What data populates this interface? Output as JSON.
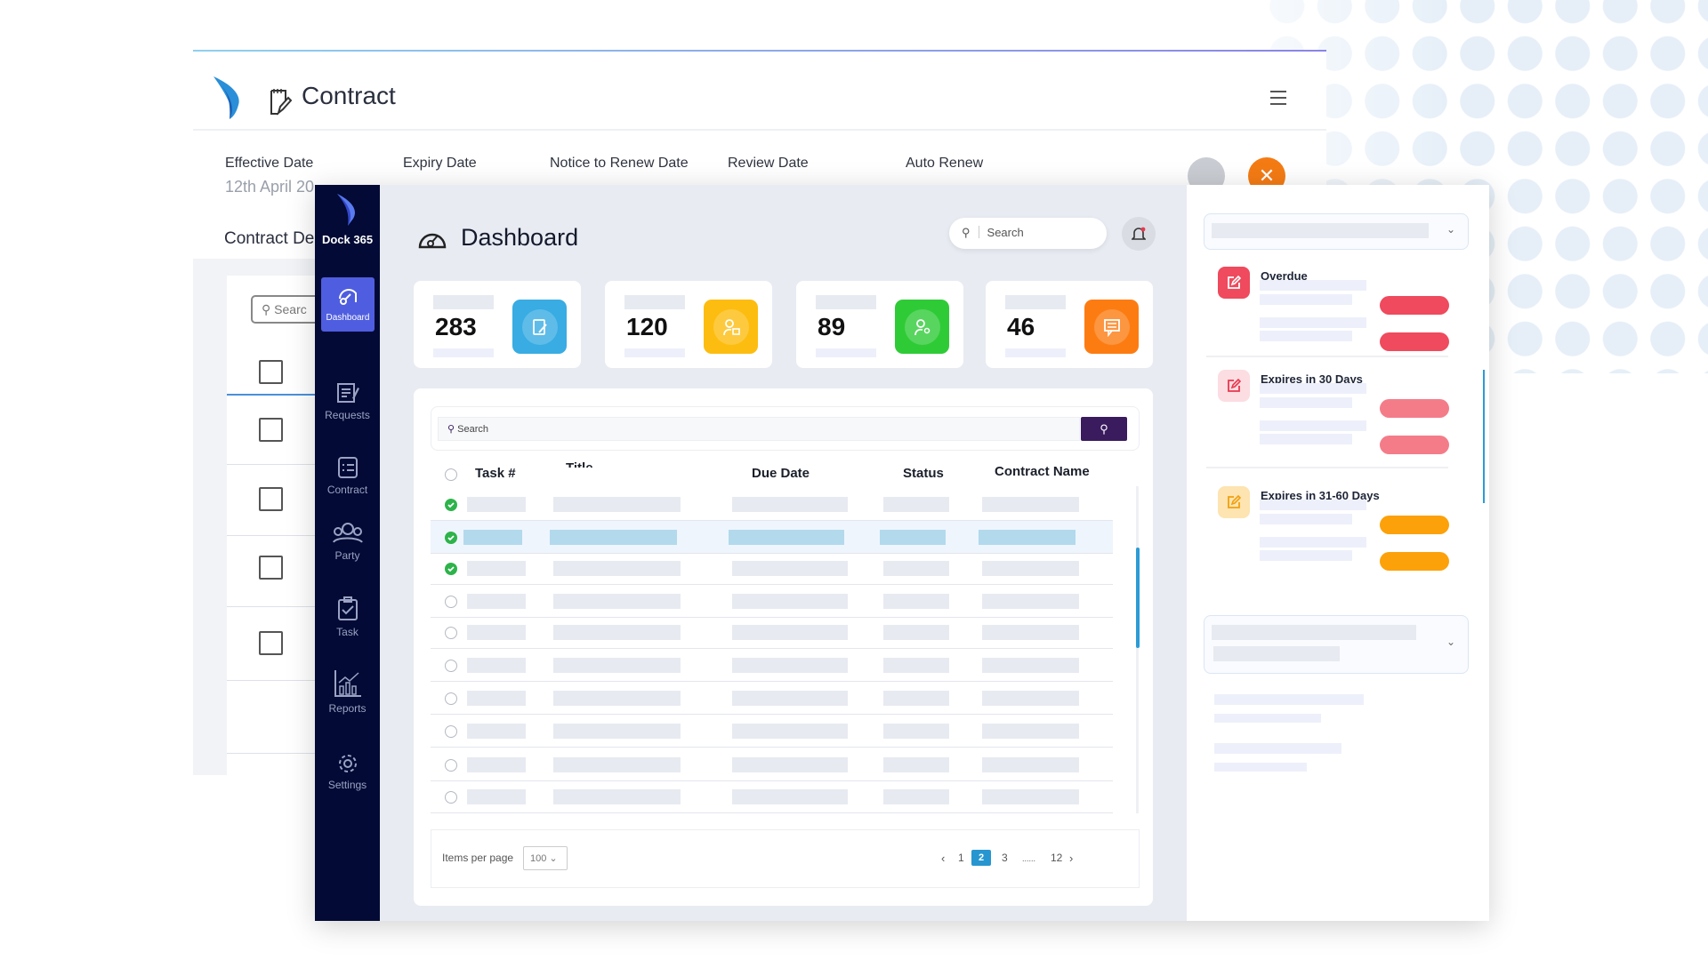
{
  "background_window": {
    "title": "Contract",
    "fields": [
      {
        "label": "Effective Date",
        "value": "12th April 20"
      },
      {
        "label": "Expiry Date",
        "value": ""
      },
      {
        "label": "Notice to Renew Date",
        "value": ""
      },
      {
        "label": "Review Date",
        "value": ""
      },
      {
        "label": "Auto Renew",
        "value": ""
      }
    ],
    "section_label": "Contract De",
    "search_placeholder": "Searc"
  },
  "sidebar": {
    "brand": "Dock 365",
    "items": [
      {
        "label": "Dashboard",
        "icon": "gauge-icon",
        "active": true
      },
      {
        "label": "Requests",
        "icon": "document-edit-icon"
      },
      {
        "label": "Contract",
        "icon": "list-icon"
      },
      {
        "label": "Party",
        "icon": "people-icon"
      },
      {
        "label": "Task",
        "icon": "clipboard-check-icon"
      },
      {
        "label": "Reports",
        "icon": "bar-chart-icon"
      },
      {
        "label": "Settings",
        "icon": "gear-icon"
      }
    ]
  },
  "header": {
    "title": "Dashboard",
    "search_placeholder": "Search"
  },
  "stats": [
    {
      "value": "283",
      "color": "#38ace3",
      "icon": "notepad-icon"
    },
    {
      "value": "120",
      "color": "#fdbd10",
      "icon": "user-lock-icon"
    },
    {
      "value": "89",
      "color": "#2fcb37",
      "icon": "user-idea-icon"
    },
    {
      "value": "46",
      "color": "#fd7c12",
      "icon": "message-icon"
    }
  ],
  "table": {
    "search_placeholder": "Search",
    "columns": [
      "Task #",
      "Title",
      "Due Date",
      "Status",
      "Contract Name"
    ],
    "row_checked": [
      true,
      true,
      true,
      false,
      false,
      false,
      false,
      false,
      false,
      false
    ],
    "highlighted_row": 2,
    "items_per_page_label": "Items per page",
    "items_per_page": "100",
    "pages": [
      "1",
      "2",
      "3",
      "......",
      "12"
    ],
    "current_page": "2"
  },
  "right_panel": {
    "sections": [
      {
        "title": "Overdue",
        "color": "#ef4a5d",
        "icon_bg": "#ef4a5d"
      },
      {
        "title": "Expires in 30 Days",
        "color": "#f47c89",
        "icon_bg": "#fcdde1"
      },
      {
        "title": "Expires in 31-60 Days",
        "color": "#fca10a",
        "icon_bg": "#fde4b0"
      }
    ]
  }
}
